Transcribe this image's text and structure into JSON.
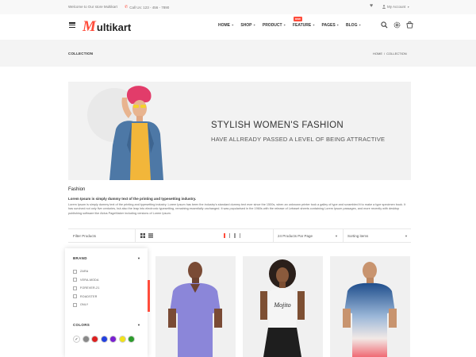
{
  "topbar": {
    "welcome": "Welcome to Our store Multikart",
    "call": "Call Us: 123 - 456 - 7890",
    "account": "My Account"
  },
  "header": {
    "logo_m": "M",
    "logo_rest": "ultikart",
    "nav": [
      {
        "label": "HOME"
      },
      {
        "label": "SHOP"
      },
      {
        "label": "PRODUCT"
      },
      {
        "label": "FEATURE",
        "badge": "new"
      },
      {
        "label": "PAGES"
      },
      {
        "label": "BLOG"
      }
    ]
  },
  "breadcrumb": {
    "page_title": "COLLECTION",
    "home": "HOME",
    "separator": "/",
    "current": "COLLECTION"
  },
  "banner": {
    "heading": "STYLISH WOMEN'S FASHION",
    "subheading": "HAVE ALLREADY PASSED A LEVEL OF BEING ATTRACTIVE"
  },
  "description": {
    "title": "Fashion",
    "subtitle": "Lorem Ipsum is simply dummy text of the printing and typesetting industry.",
    "body": "Lorem Ipsum is simply dummy text of the printing and typesetting industry. Lorem Ipsum has been the industry's standard dummy text ever since the 1500s, when an unknown printer took a galley of type and scrambled it to make a type specimen book. It has survived not only five centuries, but also the leap into electronic typesetting, remaining essentially unchanged. It was popularised in the 1960s with the release of Letraset sheets containing Lorem Ipsum passages, and more recently with desktop publishing software like Aldus PageMaker including versions of Lorem Ipsum."
  },
  "toolbar": {
    "filter_label": "Filter Products",
    "per_page": "24 Products Par Page",
    "sort": "Sorting items"
  },
  "sidebar": {
    "brand_title": "BRAND",
    "brands": [
      "ZARA",
      "VERA-MODA",
      "FOREVER-21",
      "ROADSTER",
      "ONLY"
    ],
    "colors_title": "COLORS",
    "colors": [
      "#ffffff",
      "#888888",
      "#dd1f1f",
      "#2340e0",
      "#7a1fd1",
      "#f2e31a",
      "#2c9c2c"
    ]
  },
  "colors": {
    "accent": "#ff4c3b"
  }
}
